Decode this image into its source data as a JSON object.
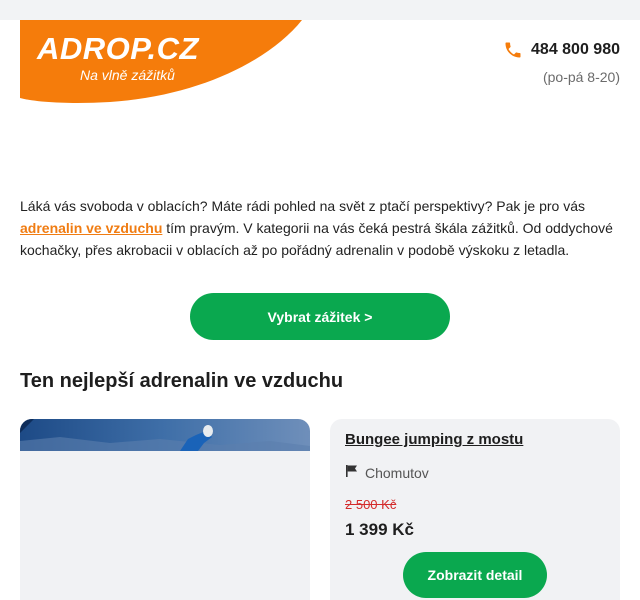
{
  "header": {
    "logo_text": "ADROP.CZ",
    "logo_tagline": "Na vlně zážitků",
    "phone_icon": "phone-icon",
    "phone_number": "484 800 980",
    "phone_hours": "(po-pá 8-20)"
  },
  "intro": {
    "text_before": "Láká vás svoboda v oblacích? Máte rádi pohled na svět z ptačí perspektivy? Pak je pro vás ",
    "link_text": "adrenalin ve vzduchu",
    "text_after": " tím pravým. V kategorii na vás čeká pestrá škála zážitků. Od oddychové kochačky, přes akrobacii v oblacích až po pořádný adrenalin v podobě výskoku z letadla."
  },
  "cta": {
    "label": "Vybrat zážitek >"
  },
  "section": {
    "title": "Ten nejlepší adrenalin ve vzduchu"
  },
  "card": {
    "title": "Bungee jumping z mostu",
    "location_icon": "flag-icon",
    "location": "Chomutov",
    "old_price": "2 500 Kč",
    "new_price": "1 399 Kč",
    "button_label": "Zobrazit detail"
  },
  "colors": {
    "brand_orange": "#f57c0b",
    "green": "#0aa84f",
    "old_price_red": "#d42b2b"
  }
}
